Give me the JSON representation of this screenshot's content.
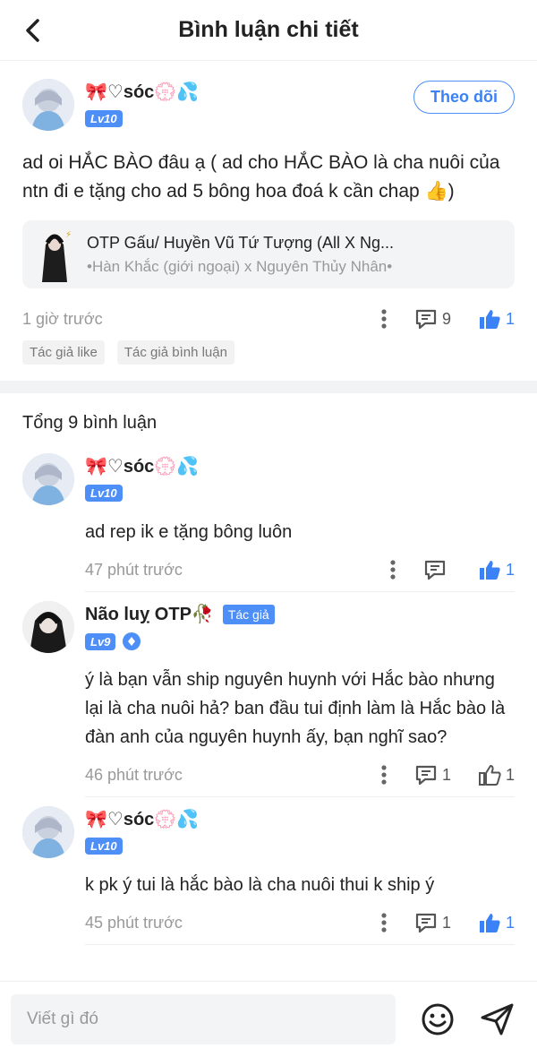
{
  "header": {
    "title": "Bình luận chi tiết"
  },
  "post": {
    "username": "🎀♡sóc💮💦",
    "level": "Lv10",
    "follow_label": "Theo dõi",
    "text": "ad oi HẮC BÀO đâu ạ ( ad cho HẮC BÀO là cha nuôi của ntn đi e tặng cho ad 5 bông hoa đoá k cần chap 👍)",
    "story": {
      "title": "OTP Gấu/ Huyền Vũ Tứ Tượng (All X Ng...",
      "subtitle": "•Hàn Khắc (giới ngoại) x Nguyên Thủy Nhân•"
    },
    "time": "1 giờ trước",
    "comment_count": "9",
    "like_count": "1",
    "tags": [
      "Tác giả like",
      "Tác giả bình luận"
    ]
  },
  "total_label": "Tổng 9 bình luận",
  "comments": [
    {
      "username": "🎀♡sóc💮💦",
      "level": "Lv10",
      "text": "ad rep ik e tặng bông luôn",
      "time": "47 phút trước",
      "reply_count": "",
      "like_count": "1",
      "liked": true
    },
    {
      "username": "Não luỵ OTP🥀",
      "author_badge": "Tác giả",
      "level": "Lv9",
      "text": "ý là bạn vẫn ship nguyên huynh với Hắc bào nhưng lại là cha nuôi hả? ban đầu tui định làm là Hắc bào là đàn anh của nguyên huynh ấy, bạn nghĩ sao?",
      "time": "46 phút trước",
      "reply_count": "1",
      "like_count": "1",
      "liked": false
    },
    {
      "username": "🎀♡sóc💮💦",
      "level": "Lv10",
      "text": "k pk ý tui là hắc bào là cha nuôi thui k ship ý",
      "time": "45 phút trước",
      "reply_count": "1",
      "like_count": "1",
      "liked": true
    }
  ],
  "footer": {
    "placeholder": "Viết gì đó"
  },
  "colors": {
    "accent": "#3b82f6",
    "level": "#4d8ef7"
  }
}
